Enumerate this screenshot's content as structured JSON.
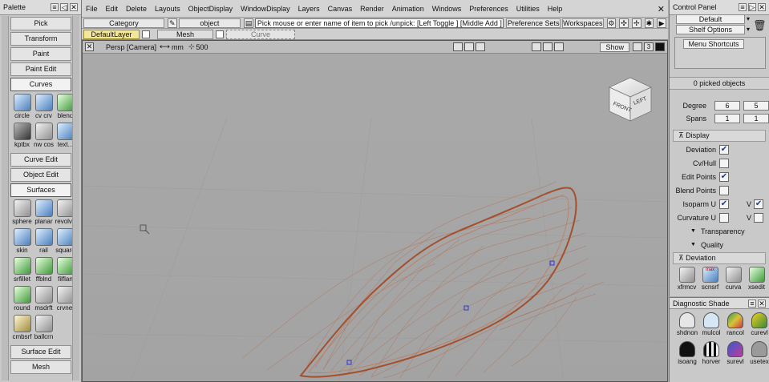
{
  "palette": {
    "title": "Palette",
    "buttons_top": [
      "Pick",
      "Transform",
      "Paint",
      "Paint Edit"
    ],
    "curves_tab": "Curves",
    "curves_tools": [
      {
        "label": "circle",
        "icon": "circle-icon"
      },
      {
        "label": "cv crv",
        "icon": "cv-curve-icon"
      },
      {
        "label": "blend",
        "icon": "blend-curve-icon"
      },
      {
        "label": "kptbx",
        "icon": "keypoint-icon"
      },
      {
        "label": "nw cos",
        "icon": "new-cos-icon"
      },
      {
        "label": "text...",
        "icon": "text-icon"
      }
    ],
    "curve_edit": "Curve Edit",
    "object_edit": "Object Edit",
    "surfaces_tab": "Surfaces",
    "surface_tools": [
      {
        "label": "sphere",
        "icon": "sphere-icon"
      },
      {
        "label": "planar",
        "icon": "planar-icon"
      },
      {
        "label": "revolve",
        "icon": "revolve-icon"
      },
      {
        "label": "skin",
        "icon": "skin-icon"
      },
      {
        "label": "rail",
        "icon": "rail-icon"
      },
      {
        "label": "square",
        "icon": "square-surface-icon"
      },
      {
        "label": "srfillet",
        "icon": "surface-fillet-icon"
      },
      {
        "label": "ffblnd",
        "icon": "freeform-blend-icon"
      },
      {
        "label": "filflan",
        "icon": "fillet-flange-icon"
      },
      {
        "label": "round",
        "icon": "round-icon"
      },
      {
        "label": "msdrft",
        "icon": "multi-surface-draft-icon"
      },
      {
        "label": "crvnet",
        "icon": "curve-network-icon"
      },
      {
        "label": "cmbsrf",
        "icon": "combine-surface-icon"
      },
      {
        "label": "ballcrn",
        "icon": "ball-corner-icon"
      }
    ],
    "surface_edit": "Surface Edit",
    "mesh": "Mesh"
  },
  "menubar": {
    "items": [
      "File",
      "Edit",
      "Delete",
      "Layouts",
      "ObjectDisplay",
      "WindowDisplay",
      "Layers",
      "Canvas",
      "Render",
      "Animation",
      "Windows",
      "Preferences",
      "Utilities",
      "Help"
    ]
  },
  "toolbar2": {
    "category": "Category",
    "object": "object",
    "prompt": "Pick mouse or enter name of item to pick /unpick: [Left Toggle ] [Middle Add ] [Right Unpick ]",
    "preference_sets": "Preference Sets",
    "workspaces": "Workspaces"
  },
  "toolbar3": {
    "default_layer": "DefaultLayer",
    "mesh_layer": "Mesh",
    "curve_layer": "Curve"
  },
  "viewport": {
    "camera": "Persp [Camera]",
    "units": "mm",
    "grid": "500",
    "show": "Show",
    "count": "3",
    "viewcube_front": "FRONT",
    "viewcube_left": "LEFT"
  },
  "control": {
    "title": "Control Panel",
    "default": "Default",
    "shelf_options": "Shelf Options",
    "menu_shortcuts": "Menu Shortcuts",
    "picked": "0 picked objects",
    "degree_label": "Degree",
    "degree": [
      "6",
      "5"
    ],
    "spans_label": "Spans",
    "spans": [
      "1",
      "1"
    ],
    "display_label": "Display",
    "rows": [
      {
        "label": "Deviation",
        "checked": true
      },
      {
        "label": "Cv/Hull",
        "checked": false
      },
      {
        "label": "Edit Points",
        "checked": true
      },
      {
        "label": "Blend Points",
        "checked": false
      }
    ],
    "isoparm_u": "Isoparm U",
    "v_label": "V",
    "curvature_u": "Curvature U",
    "transparency": "Transparency",
    "quality": "Quality",
    "deviation_section": "Deviation",
    "shelf_tools": [
      "xfrmcv",
      "scnsrf",
      "curva",
      "xsedit"
    ],
    "shelf_max": "max"
  },
  "diag": {
    "title": "Diagnostic Shade",
    "items": [
      {
        "label": "shdnon",
        "color": "#e6e6e6"
      },
      {
        "label": "mulcol",
        "color": "#d7e6f5"
      },
      {
        "label": "rancol",
        "color": "#d9c23a"
      },
      {
        "label": "curevl",
        "color": "#f0d020"
      },
      {
        "label": "isoang",
        "color": "#111111"
      },
      {
        "label": "horver",
        "color": "#f2f2f2"
      },
      {
        "label": "surevl",
        "color": "#c03a9a"
      },
      {
        "label": "usetex",
        "color": "#9a9a9a"
      }
    ]
  },
  "colors": {
    "wire": "#b8603a",
    "wire_outline": "#a04a28",
    "cv_point": "#2a3ad0",
    "check": "#1a3c8a",
    "default_layer_bg": "#f2e79a"
  }
}
